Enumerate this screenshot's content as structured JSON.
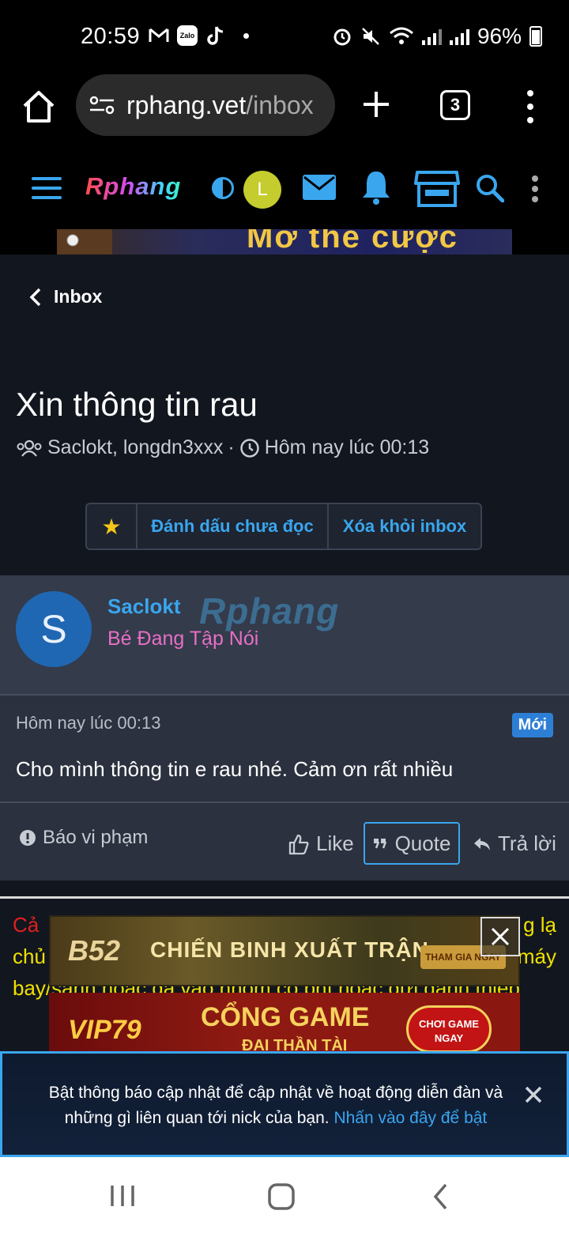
{
  "status": {
    "time": "20:59",
    "battery": "96%"
  },
  "browser": {
    "url_host": "rphang.vet",
    "url_path": "/inbox",
    "tab_count": "3"
  },
  "site": {
    "logo": "Rphang",
    "avatar_letter": "L"
  },
  "banner_top_text": "Mở thẻ cược",
  "nav": {
    "back_label": "Inbox"
  },
  "conversation": {
    "title": "Xin thông tin rau",
    "participants": "Saclokt, longdn3xxx",
    "separator": "·",
    "time": "Hôm nay lúc 00:13"
  },
  "actions": {
    "star": "★",
    "mark_unread": "Đánh dấu chưa đọc",
    "remove": "Xóa khỏi inbox"
  },
  "message": {
    "avatar_letter": "S",
    "username": "Saclokt",
    "user_title": "Bé Đang Tập Nói",
    "watermark": "Rphang",
    "date": "Hôm nay lúc 00:13",
    "badge": "Mới",
    "text": "Cho mình thông tin e rau nhé. Cảm ơn rất nhiều",
    "report": "Báo vi phạm",
    "like": "Like",
    "quote": "Quote",
    "reply": "Trả lời"
  },
  "promo": {
    "line1_start": "Cả",
    "line1_end": "g lạ",
    "line2_start": "chủ",
    "line2_end": "máy",
    "line3": "bay/sành hoặc gà vào nhóm có phí hoặc gửi danh thiếp"
  },
  "ads": {
    "ad1_brand": "B52",
    "ad1_title": "CHIẾN BINH XUẤT TRẬN",
    "ad1_cta": "THAM GIA NGAY",
    "ad2_brand": "VIP79",
    "ad2_title": "CỔNG GAME",
    "ad2_subtitle": "ĐẠI THẦN TÀI",
    "ad2_cta": "CHƠI GAME NGAY"
  },
  "notification": {
    "text": "Bật thông báo cập nhật để cập nhật về hoạt động diễn đàn và những gì liên quan tới nick của bạn.",
    "link": "Nhấn vào đây để bật"
  },
  "colors": {
    "accent": "#3aa6ee",
    "page_bg": "#12161f",
    "user_title": "#e86fc6",
    "badge": "#2d7fd6"
  }
}
